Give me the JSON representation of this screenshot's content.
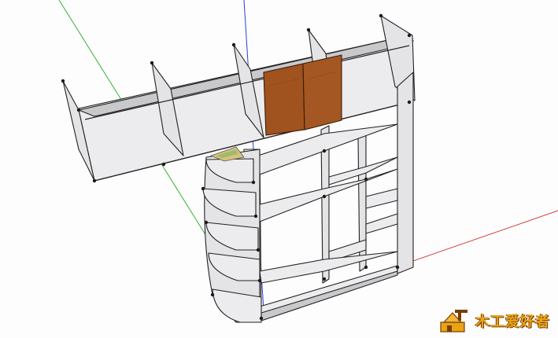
{
  "viewport": {
    "background": "#fdfdfd",
    "axis_colors": {
      "red": "#d23a3a",
      "green": "#35b035",
      "blue": "#2a3fd0"
    }
  },
  "model": {
    "panel_color": "#e4e4e6",
    "edge_color": "#222222",
    "door_wood_color": "#a0521f"
  },
  "watermark": {
    "text": "木工爱好者",
    "icon": "carpenter-logo-icon",
    "color": "#e8a416"
  }
}
